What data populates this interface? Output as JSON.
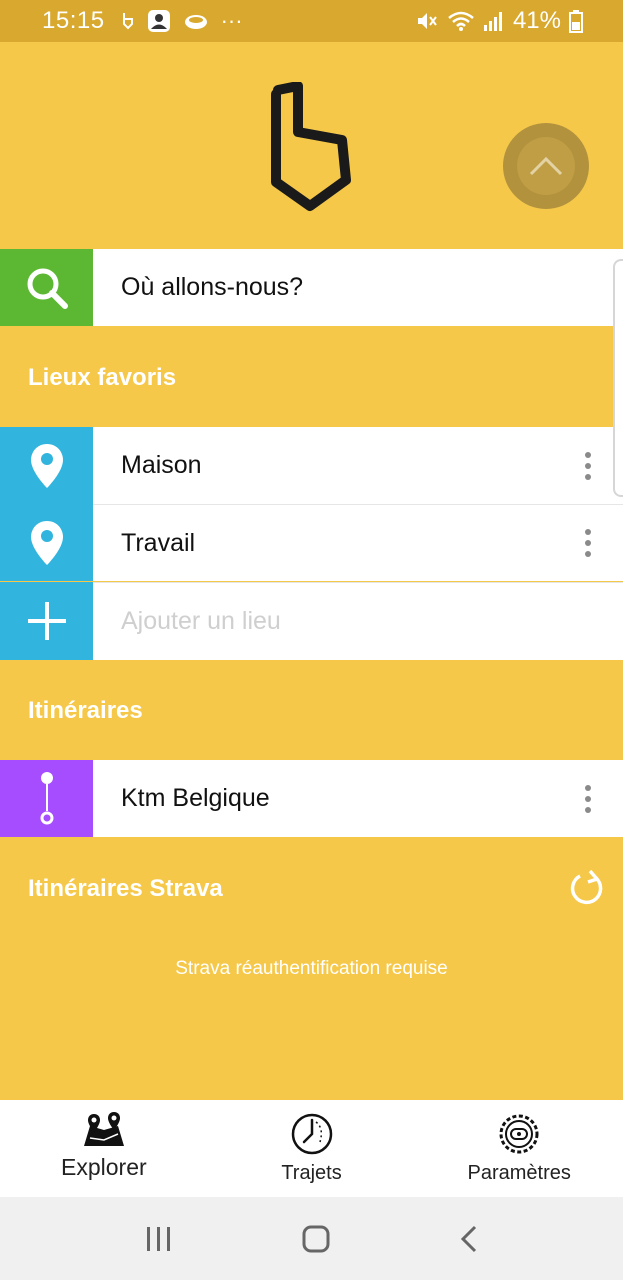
{
  "status_bar": {
    "time": "15:15",
    "battery": "41%",
    "icons": [
      "muted-icon",
      "wifi-icon",
      "signal-icon",
      "battery-icon"
    ]
  },
  "search": {
    "placeholder": "Où allons-nous?"
  },
  "favorites": {
    "title": "Lieux favoris",
    "items": [
      {
        "label": "Maison"
      },
      {
        "label": "Travail"
      }
    ],
    "add_placeholder": "Ajouter un lieu"
  },
  "routes": {
    "title": "Itinéraires",
    "items": [
      {
        "label": "Ktm Belgique"
      }
    ]
  },
  "strava": {
    "title": "Itinéraires Strava",
    "message": "Strava réauthentification requise"
  },
  "bottom_nav": {
    "explorer": "Explorer",
    "trips": "Trajets",
    "settings": "Paramètres"
  },
  "colors": {
    "background": "#f5c84a",
    "search_green": "#5cb832",
    "favorites_blue": "#31b4dd",
    "routes_purple": "#a64dff"
  }
}
